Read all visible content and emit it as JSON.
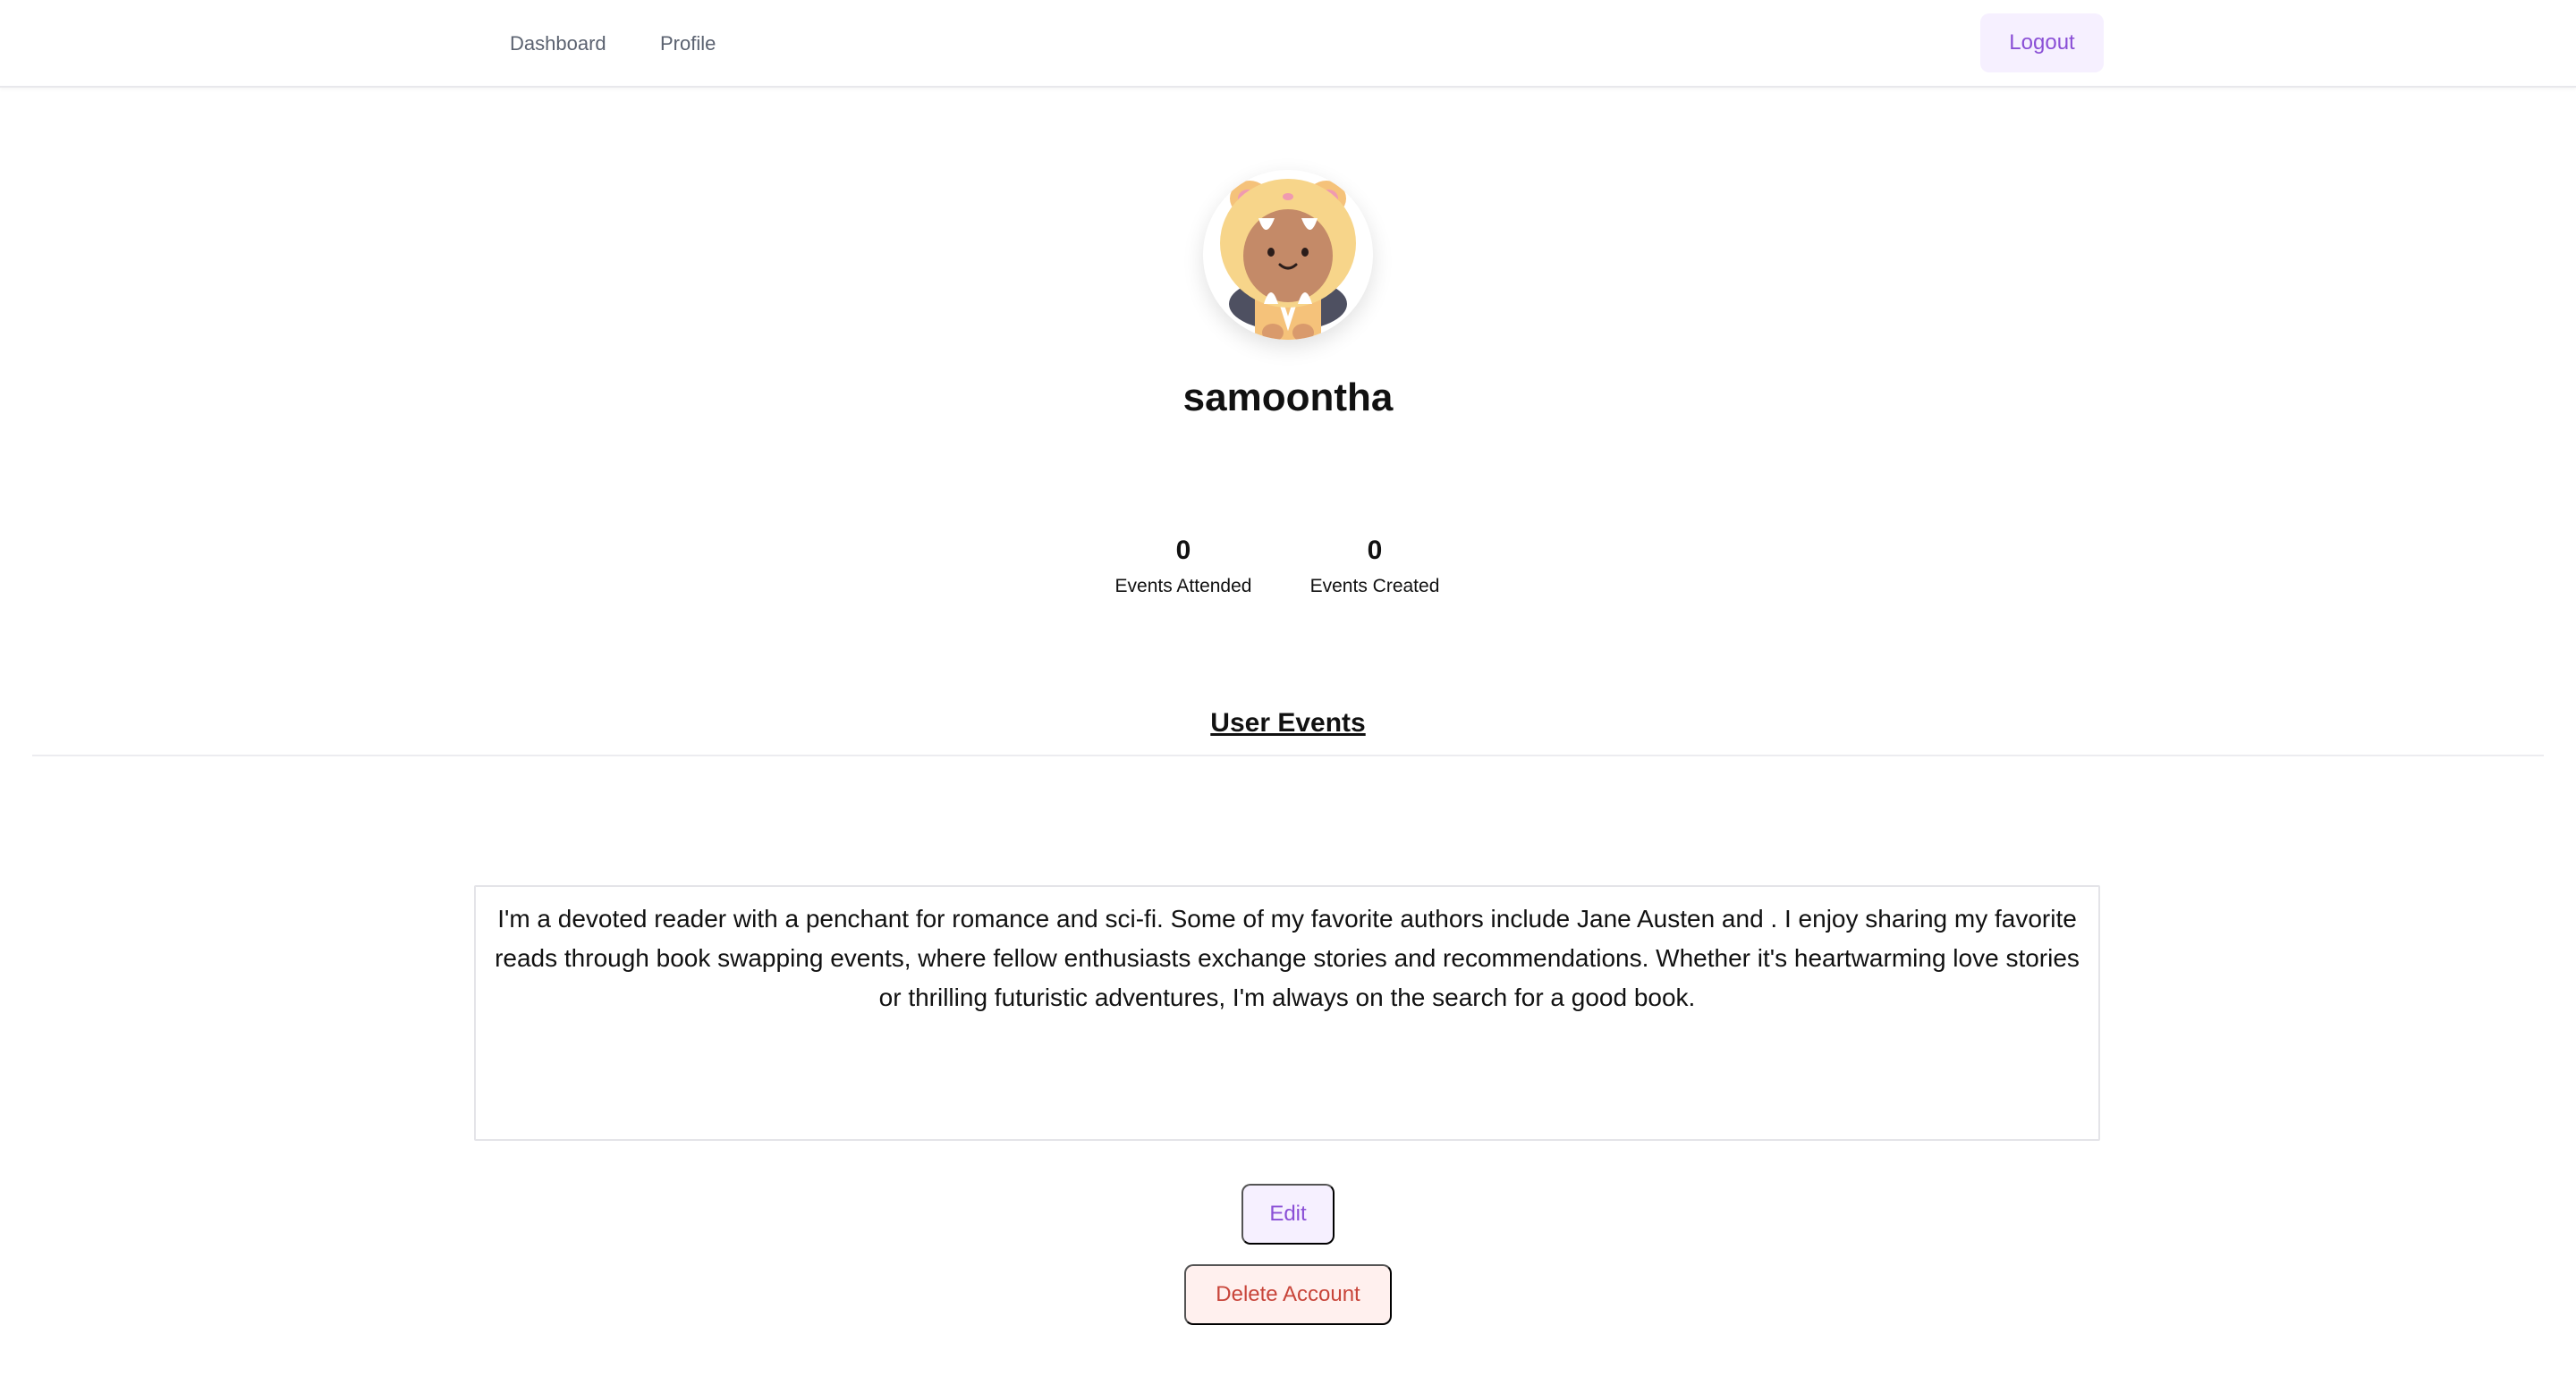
{
  "nav": {
    "items": [
      {
        "label": "Dashboard"
      },
      {
        "label": "Profile"
      }
    ],
    "logout_label": "Logout"
  },
  "profile": {
    "avatar_icon": "tiger-costume-avatar-icon",
    "username": "samoontha",
    "stats": {
      "attended": {
        "value": "0",
        "label": "Events Attended"
      },
      "created": {
        "value": "0",
        "label": "Events Created"
      }
    },
    "section_title": "User Events",
    "bio": "I'm a devoted reader with a penchant for romance and sci-fi. Some of my favorite authors include Jane Austen and . I enjoy sharing my favorite reads through book swapping events, where fellow enthusiasts exchange stories and recommendations. Whether it's heartwarming love stories or thrilling futuristic adventures, I'm always on the search for a good book.",
    "edit_label": "Edit",
    "delete_label": "Delete Account"
  },
  "colors": {
    "accent": "#8a4fd6",
    "accent_bg": "#f6f0ff",
    "danger": "#c8453a",
    "danger_bg": "#fff0ee"
  }
}
